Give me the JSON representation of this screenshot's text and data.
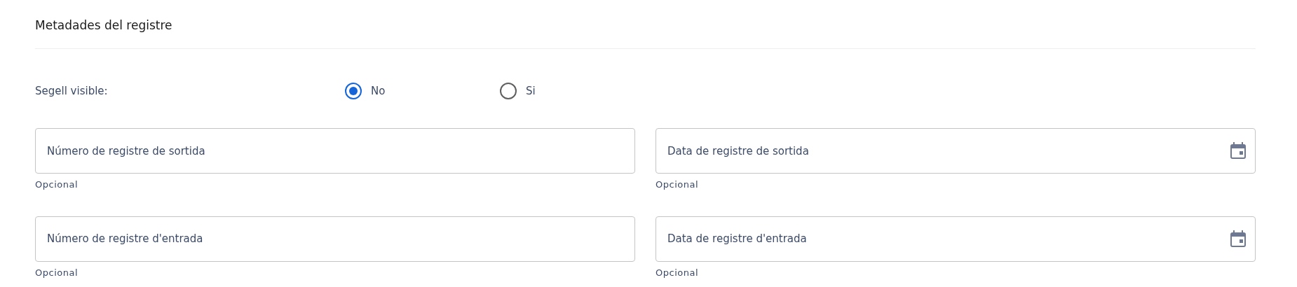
{
  "section": {
    "title": "Metadades del registre"
  },
  "seal": {
    "label": "Segell visible:",
    "options": [
      {
        "label": "No",
        "selected": true
      },
      {
        "label": "Si",
        "selected": false
      }
    ]
  },
  "fields": [
    {
      "kind": "text",
      "placeholder": "Número de registre de sortida",
      "hint": "Opcional"
    },
    {
      "kind": "date",
      "placeholder": "Data de registre de sortida",
      "hint": "Opcional"
    },
    {
      "kind": "text",
      "placeholder": "Número de registre d'entrada",
      "hint": "Opcional"
    },
    {
      "kind": "date",
      "placeholder": "Data de registre d'entrada",
      "hint": "Opcional"
    }
  ]
}
